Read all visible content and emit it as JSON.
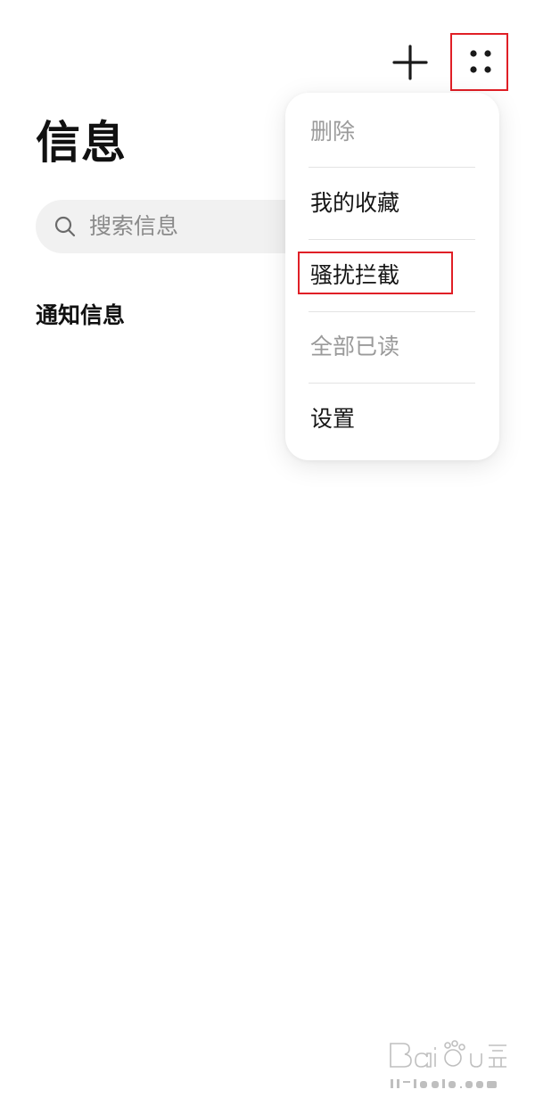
{
  "header": {
    "add_icon": "plus-icon",
    "more_icon": "more-dots-icon"
  },
  "page": {
    "title": "信息"
  },
  "search": {
    "icon": "search-icon",
    "placeholder": "搜索信息"
  },
  "section": {
    "heading": "通知信息"
  },
  "menu": {
    "items": [
      {
        "label": "删除",
        "enabled": false
      },
      {
        "label": "我的收藏",
        "enabled": true
      },
      {
        "label": "骚扰拦截",
        "enabled": true,
        "highlighted": true
      },
      {
        "label": "全部已读",
        "enabled": false
      },
      {
        "label": "设置",
        "enabled": true
      }
    ]
  },
  "annotations": {
    "highlight_color": "#e01f26"
  },
  "watermark": {
    "brand": "Baidu经验",
    "url": "jingyan.baidu.com"
  }
}
